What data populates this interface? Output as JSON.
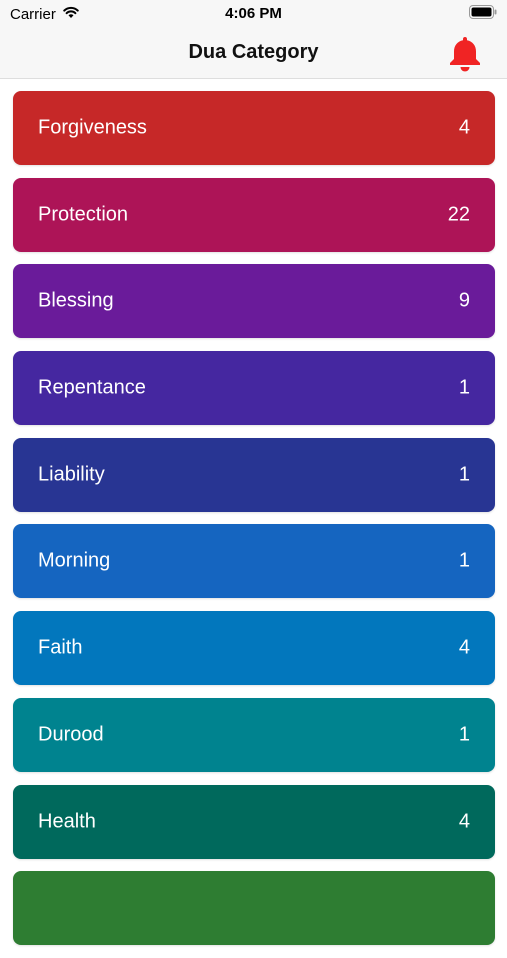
{
  "status_bar": {
    "carrier": "Carrier",
    "time": "4:06 PM"
  },
  "header": {
    "title": "Dua Category"
  },
  "categories": [
    {
      "label": "Forgiveness",
      "count": "4",
      "color": "#c62828"
    },
    {
      "label": "Protection",
      "count": "22",
      "color": "#ad1457"
    },
    {
      "label": "Blessing",
      "count": "9",
      "color": "#6a1b9a"
    },
    {
      "label": "Repentance",
      "count": "1",
      "color": "#4527a0"
    },
    {
      "label": "Liability",
      "count": "1",
      "color": "#283593"
    },
    {
      "label": "Morning",
      "count": "1",
      "color": "#1565c0"
    },
    {
      "label": "Faith",
      "count": "4",
      "color": "#0277bd"
    },
    {
      "label": "Durood",
      "count": "1",
      "color": "#00838f"
    },
    {
      "label": "Health",
      "count": "4",
      "color": "#00695c"
    },
    {
      "label": "",
      "count": "",
      "color": "#2e7d32"
    }
  ],
  "colors": {
    "bell": "#f02424",
    "nav_background": "#f7f7f7"
  }
}
